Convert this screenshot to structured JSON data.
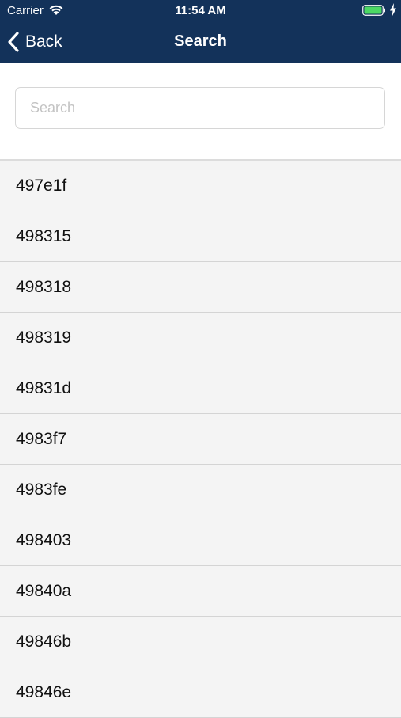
{
  "status_bar": {
    "carrier": "Carrier",
    "time": "11:54 AM",
    "battery_color": "#4cd964"
  },
  "nav": {
    "back_label": "Back",
    "title": "Search",
    "bar_color": "#13325a"
  },
  "search": {
    "placeholder": "Search",
    "value": ""
  },
  "results": [
    "497e1f",
    "498315",
    "498318",
    "498319",
    "49831d",
    "4983f7",
    "4983fe",
    "498403",
    "49840a",
    "49846b",
    "49846e"
  ]
}
